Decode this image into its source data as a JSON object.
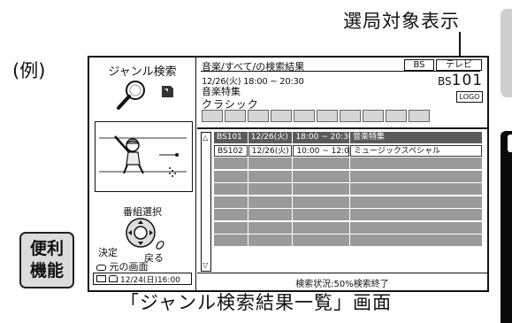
{
  "annotations": {
    "top_label": "選局対象表示",
    "example_label": "(例)",
    "caption": "「ジャンル検索結果一覧」画面",
    "benri_line1": "便利",
    "benri_line2": "機能"
  },
  "left_panel": {
    "title": "ジャンル検索",
    "bangumi_label": "番組選択",
    "kettei_label": "決定",
    "modoru_label": "戻る",
    "moto_label": "元の画面",
    "datetime": "12/24(日)16:00"
  },
  "header": {
    "breadcrumb": "音楽/すべて/の検索結果",
    "chip_bs": "BS",
    "chip_tv": "テレビ",
    "time": "12/26(火) 18:00 ~ 20:30",
    "program": "音楽特集",
    "genre": "クラシック",
    "channel_prefix": "BS",
    "channel_number": "101",
    "logo": "LOGO"
  },
  "results": [
    {
      "ch": "BS101",
      "date": "12/26(火)",
      "time": "18:00 ~ 20:30",
      "title": "音楽特集",
      "highlighted": true
    },
    {
      "ch": "BS102",
      "date": "12/26(火)",
      "time": "10:00 ~ 12:00",
      "title": "ミュージックスペシャル",
      "highlighted": false
    }
  ],
  "empty_rows": 7,
  "status_text": "検索状況:50%検索終了",
  "colors": {
    "highlight_row": "#5a5a5a",
    "empty_row": "#9a9a9a",
    "swatch": "#d6d6d6"
  }
}
